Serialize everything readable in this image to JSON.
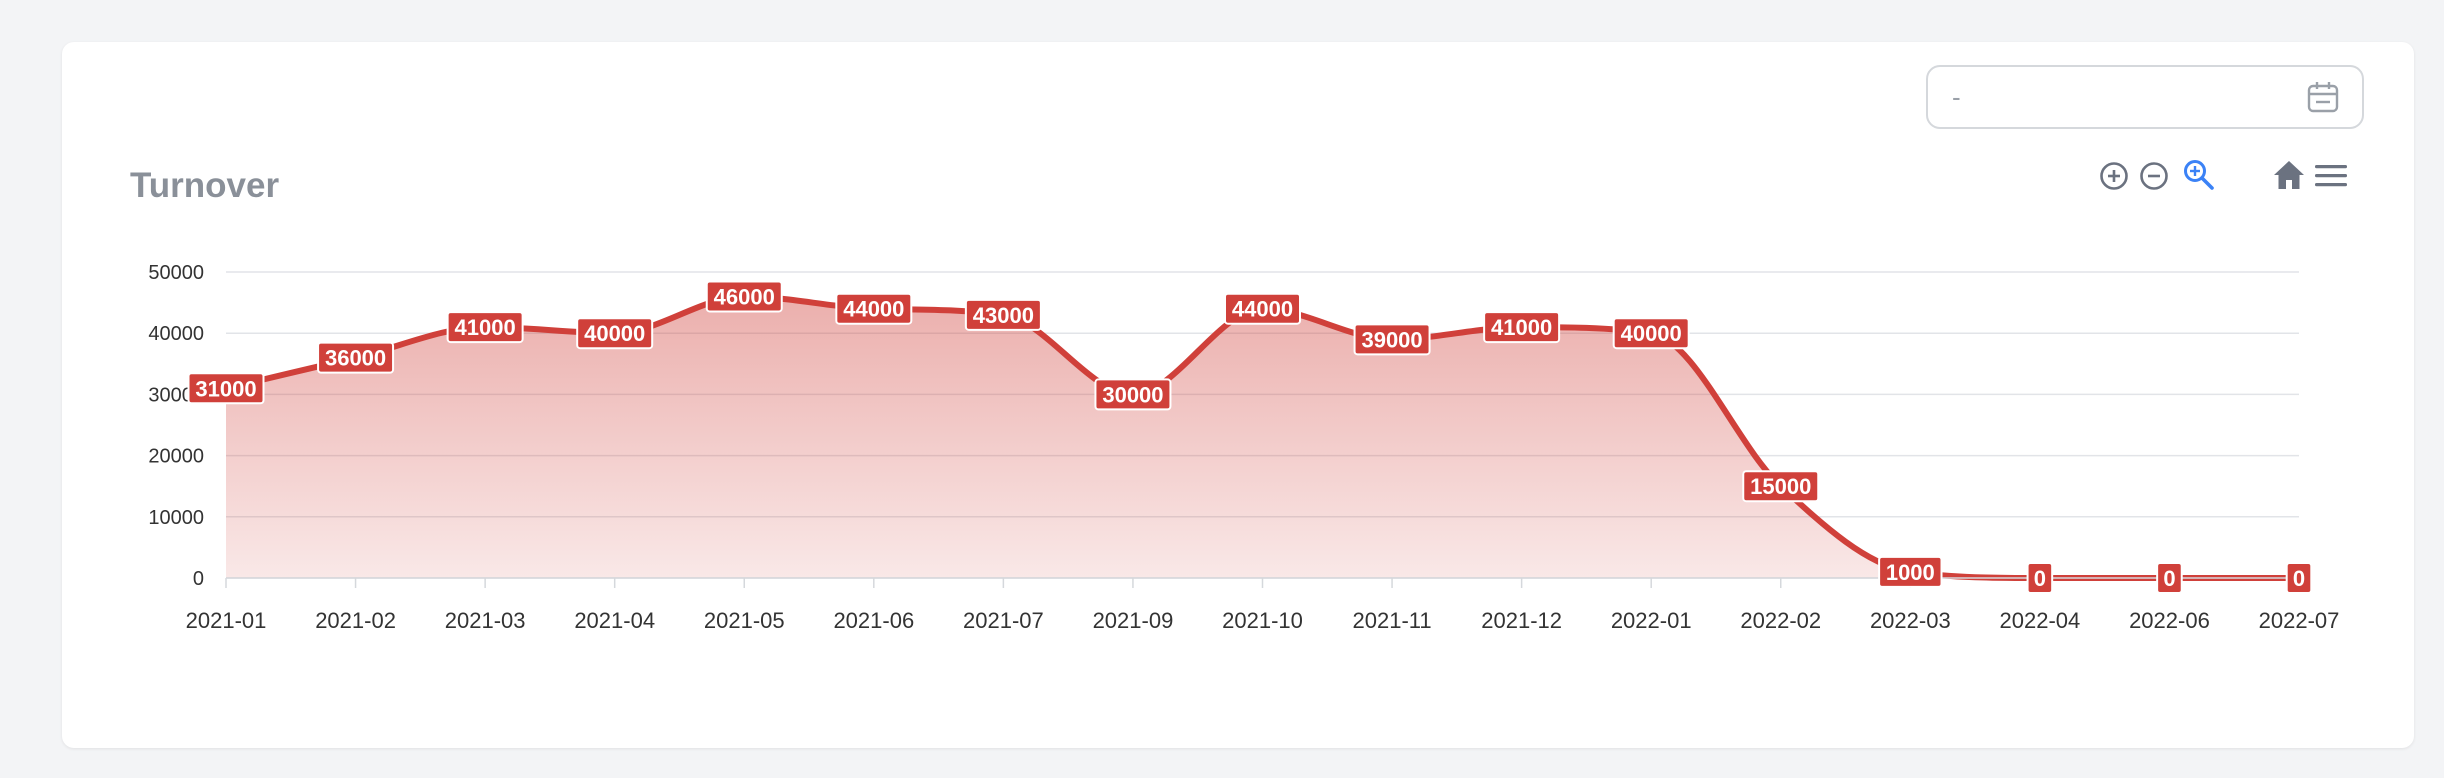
{
  "date_range": {
    "value": "-"
  },
  "toolbar": {
    "icons": [
      "zoom-in-icon",
      "zoom-out-icon",
      "selection-zoom-icon",
      "home-icon",
      "menu-icon"
    ]
  },
  "colors": {
    "series": "#d0403a",
    "label_bg": "#d0403a",
    "active_icon": "#3b82f6",
    "icon": "#6b7280"
  },
  "chart_data": {
    "type": "area",
    "title": "Turnover",
    "categories": [
      "2021-01",
      "2021-02",
      "2021-03",
      "2021-04",
      "2021-05",
      "2021-06",
      "2021-07",
      "2021-09",
      "2021-10",
      "2021-11",
      "2021-12",
      "2022-01",
      "2022-02",
      "2022-03",
      "2022-04",
      "2022-06",
      "2022-07"
    ],
    "series": [
      {
        "values": [
          31000,
          36000,
          41000,
          40000,
          46000,
          44000,
          43000,
          30000,
          44000,
          39000,
          41000,
          40000,
          15000,
          1000,
          0,
          0,
          0
        ]
      }
    ],
    "yticks": [
      "0",
      "10000",
      "20000",
      "30000",
      "40000",
      "50000"
    ],
    "ylim": [
      0,
      50000
    ],
    "grid": true,
    "smooth": true
  }
}
